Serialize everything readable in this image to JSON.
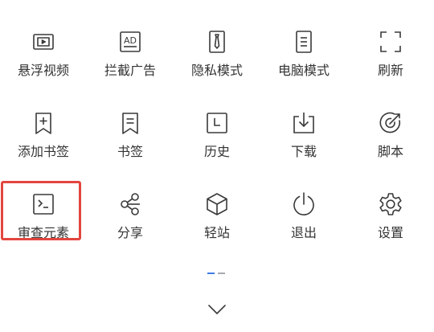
{
  "menu": {
    "items": [
      {
        "label": "悬浮视频",
        "icon": "floating-video-icon"
      },
      {
        "label": "拦截广告",
        "icon": "ad-block-icon"
      },
      {
        "label": "隐私模式",
        "icon": "privacy-tie-icon"
      },
      {
        "label": "电脑模式",
        "icon": "desktop-mode-icon"
      },
      {
        "label": "刷新",
        "icon": "refresh-icon"
      },
      {
        "label": "添加书签",
        "icon": "add-bookmark-icon"
      },
      {
        "label": "书签",
        "icon": "bookmark-icon"
      },
      {
        "label": "历史",
        "icon": "history-icon"
      },
      {
        "label": "下载",
        "icon": "download-icon"
      },
      {
        "label": "脚本",
        "icon": "script-icon"
      },
      {
        "label": "审查元素",
        "icon": "inspect-element-icon",
        "highlighted": true
      },
      {
        "label": "分享",
        "icon": "share-icon"
      },
      {
        "label": "轻站",
        "icon": "light-site-icon"
      },
      {
        "label": "退出",
        "icon": "power-icon"
      },
      {
        "label": "设置",
        "icon": "settings-gear-icon"
      }
    ]
  },
  "pager": {
    "pages": 2,
    "current": 1,
    "active_color": "#3d7be6",
    "inactive_color": "#a8aab0"
  },
  "collapse_icon": "chevron-down-icon",
  "colors": {
    "icon": "#3a3a3a",
    "label": "#333333",
    "highlight": "#e2463f"
  }
}
